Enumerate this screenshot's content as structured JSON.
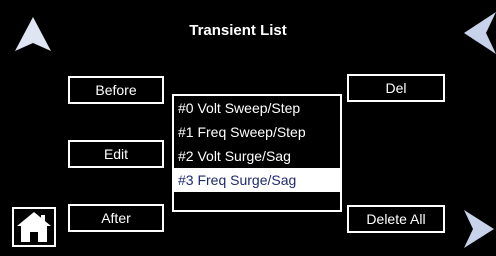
{
  "header": {
    "title": "Transient List"
  },
  "buttons": {
    "before": "Before",
    "edit": "Edit",
    "after": "After",
    "del": "Del",
    "delete_all": "Delete All"
  },
  "transients": [
    {
      "label": "#0 Volt Sweep/Step",
      "selected": false
    },
    {
      "label": "#1 Freq Sweep/Step",
      "selected": false
    },
    {
      "label": "#2 Volt Surge/Sag",
      "selected": false
    },
    {
      "label": "#3 Freq Surge/Sag",
      "selected": true
    }
  ],
  "icons": {
    "up": "up-arrow-icon",
    "left": "left-arrow-icon",
    "right": "right-arrow-icon",
    "home": "home-icon"
  },
  "colors": {
    "background": "#000000",
    "foreground": "#ffffff",
    "selected_text": "#1e2b6e",
    "arrow_accent": "#c8d2ea"
  }
}
